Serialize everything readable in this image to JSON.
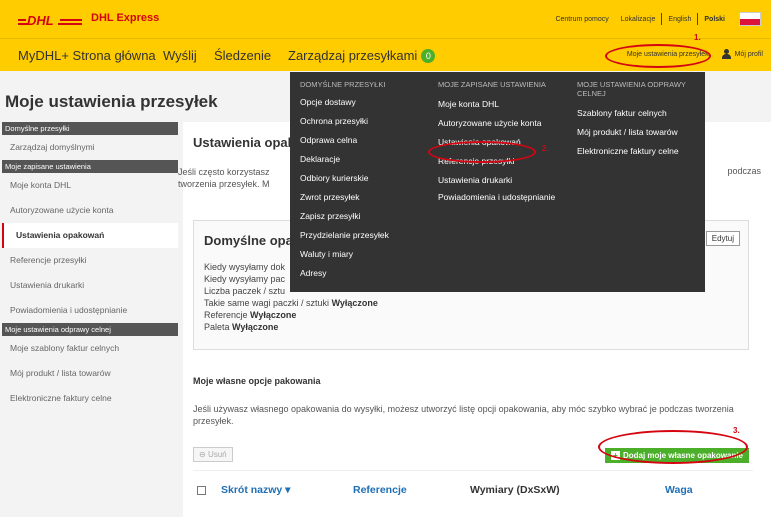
{
  "brand": {
    "name": "DHL Express",
    "logo_text": "DHL"
  },
  "top_links": [
    "Centrum pomocy",
    "Lokalizacje",
    "English",
    "Polski"
  ],
  "nav": {
    "items": [
      "MyDHL+ Strona główna",
      "Wyślij",
      "Śledzenie",
      "Zarządzaj przesyłkami"
    ],
    "badge": "0",
    "settings_link": "Moje ustawienia przesyłek",
    "profile_link": "Mój profil"
  },
  "page_title": "Moje ustawienia przesyłek",
  "sidebar": {
    "sections": [
      {
        "head": "Domyślne przesyłki",
        "items": [
          "Zarządzaj domyślnymi"
        ]
      },
      {
        "head": "Moje zapisane ustawienia",
        "items": [
          "Moje konta DHL",
          "Autoryzowane użycie konta",
          "Ustawienia opakowań",
          "Referencje przesyłki",
          "Ustawienia drukarki",
          "Powiadomienia i udostępnianie"
        ]
      },
      {
        "head": "Moje ustawienia odprawy celnej",
        "items": [
          "Moje szablony faktur celnych",
          "Mój produkt / lista towarów",
          "Elektroniczne faktury celne"
        ]
      }
    ]
  },
  "content": {
    "title": "Ustawienia opak",
    "desc_line1": "Jeśli często korzystasz",
    "desc_line1_end": "podczas",
    "desc_line2": "tworzenia przesyłek. M",
    "defaults_title": "Domyślne opa",
    "edit_label": "Edytuj",
    "lines": [
      {
        "text": "Kiedy wysyłamy dok",
        "value": ""
      },
      {
        "text": "Kiedy wysyłamy pac",
        "value": ""
      },
      {
        "text": "Liczba paczek / sztu",
        "value": ""
      },
      {
        "text": "Takie same wagi paczki / sztuki",
        "value": "Wyłączone"
      },
      {
        "text": "Referencje",
        "value": "Wyłączone"
      },
      {
        "text": "Paleta",
        "value": "Wyłączone"
      }
    ],
    "own_title": "Moje własne opcje pakowania",
    "own_desc": "Jeśli używasz własnego opakowania do wysyłki, możesz utworzyć listę opcji opakowania, aby móc szybko wybrać je podczas tworzenia przesyłek.",
    "delete_label": "Usuń",
    "add_label": "Dodaj moje własne opakowanie",
    "columns": [
      "Skrót nazwy ▾",
      "Referencje",
      "Wymiary (DxSxW)",
      "Waga"
    ]
  },
  "mega_menu": {
    "columns": [
      {
        "head": "DOMYŚLNE PRZESYŁKI",
        "items": [
          "Opcje dostawy",
          "Ochrona przesyłki",
          "Odprawa celna",
          "Deklaracje",
          "Odbiory kurierskie",
          "Zwrot przesyłek",
          "Zapisz przesyłki",
          "Przydzielanie przesyłek",
          "Waluty i miary",
          "Adresy"
        ]
      },
      {
        "head": "MOJE ZAPISANE USTAWIENIA",
        "items": [
          "Moje konta DHL",
          "Autoryzowane użycie konta",
          "Ustawienia opakowań",
          "Referencje przesyłki",
          "Ustawienia drukarki",
          "Powiadomienia i udostępnianie"
        ]
      },
      {
        "head": "MOJE USTAWIENIA ODPRAWY CELNEJ",
        "items": [
          "Szablony faktur celnych",
          "Mój produkt / lista towarów",
          "Elektroniczne faktury celne"
        ]
      }
    ]
  },
  "annotations": [
    "1.",
    "2.",
    "3."
  ],
  "colors": {
    "brand_yellow": "#ffcc00",
    "brand_red": "#d40511",
    "menu_bg": "#333333",
    "accent_green": "#4caf2a",
    "link_blue": "#1f6fb5"
  }
}
